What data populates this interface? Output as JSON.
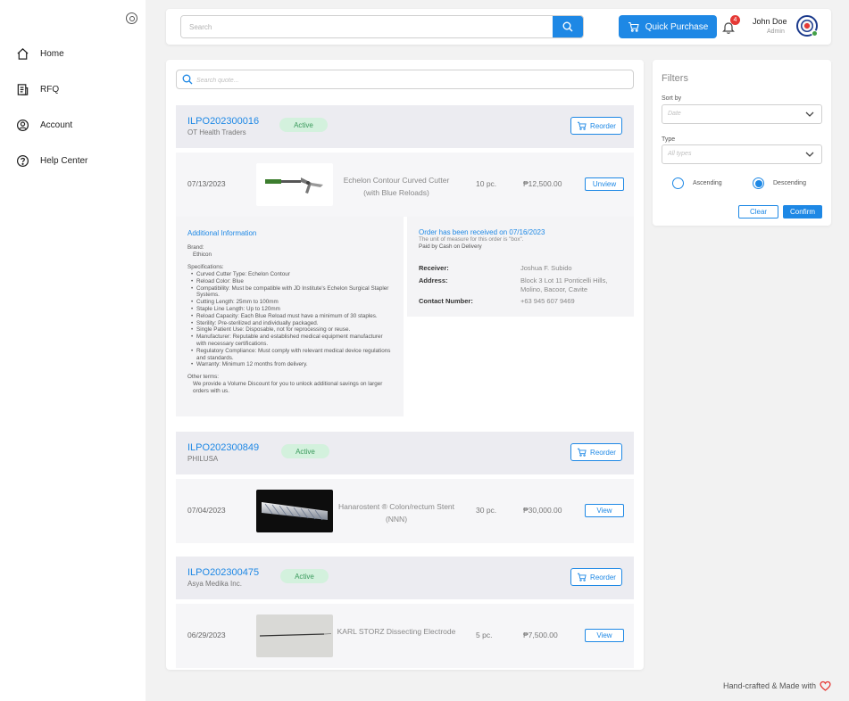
{
  "sidebar": {
    "items": [
      {
        "label": "Home",
        "icon": "home-icon"
      },
      {
        "label": "RFQ",
        "icon": "document-icon"
      },
      {
        "label": "Account",
        "icon": "user-circle-icon"
      },
      {
        "label": "Help Center",
        "icon": "help-icon"
      }
    ]
  },
  "topbar": {
    "search_placeholder": "Search",
    "quick_purchase": "Quick Purchase",
    "notification_count": "4",
    "user_name": "John Doe",
    "user_role": "Admin"
  },
  "quotes": {
    "search_placeholder": "Search quote..."
  },
  "orders": [
    {
      "id": "ILPO202300016",
      "vendor": "OT Health Traders",
      "status": "Active",
      "reorder_label": "Reorder",
      "date": "07/13/2023",
      "product": "Echelon Contour Curved Cutter (with Blue Reloads)",
      "qty": "10 pc.",
      "price": "₱12,500.00",
      "action": "Unview"
    },
    {
      "id": "ILPO202300849",
      "vendor": "PHILUSA",
      "status": "Active",
      "reorder_label": "Reorder",
      "date": "07/04/2023",
      "product": "Hanarostent ® Colon/rectum Stent (NNN)",
      "qty": "30 pc.",
      "price": "₱30,000.00",
      "action": "View"
    },
    {
      "id": "ILPO202300475",
      "vendor": "Asya Medika Inc.",
      "status": "Active",
      "reorder_label": "Reorder",
      "date": "06/29/2023",
      "product": "KARL STORZ Dissecting Electrode",
      "qty": "5 pc.",
      "price": "₱7,500.00",
      "action": "View"
    }
  ],
  "details": {
    "title": "Additional Information",
    "brand_label": "Brand:",
    "brand": "Ethicon",
    "specs_label": "Specifications:",
    "specs": [
      "Curved Cutter Type: Echelon Contour",
      "Reload Color: Blue",
      "Compatibility: Must be compatible with JD Institute's Echelon Surgical Stapler Systems.",
      "Cutting Length: 25mm to 100mm",
      "Staple Line Length: Up to 120mm",
      "Reload Capacity: Each Blue Reload must have a minimum of 30 staples.",
      "Sterility: Pre-sterilized and individually packaged.",
      "Single Patient Use: Disposable, not for reprocessing or reuse.",
      "Manufacturer: Reputable and established medical equipment manufacturer with necessary certifications.",
      "Regulatory Compliance: Must comply with relevant medical device regulations and standards.",
      "Warranty: Minimum 12 months from delivery."
    ],
    "other_label": "Other terms:",
    "other": "We provide a Volume Discount for you to unlock additional savings on larger orders with us."
  },
  "receipt": {
    "title": "Order has been received on 07/16/2023",
    "unit_note": "The unit of measure for this order is \"box\".",
    "payment": "Paid by Cash on Delivery",
    "receiver_label": "Receiver:",
    "receiver": "Joshua F. Subido",
    "address_label": "Address:",
    "address": "Block 3 Lot 11 Ponticelli Hills, Molino, Bacoor, Cavite",
    "contact_label": "Contact Number:",
    "contact": "+63 945 607 9469"
  },
  "filters": {
    "title": "Filters",
    "sort_label": "Sort by",
    "sort_value": "Date",
    "type_label": "Type",
    "type_value": "All types",
    "ascending": "Ascending",
    "descending": "Descending",
    "selected_order": "descending",
    "clear": "Clear",
    "confirm": "Confirm"
  },
  "footer": {
    "text": "Hand-crafted & Made with"
  },
  "colors": {
    "accent": "#1e88e5",
    "badge_bg": "#d3f1dd",
    "badge_text": "#3a9a5c",
    "notification": "#e53935",
    "heart": "#e53935"
  }
}
